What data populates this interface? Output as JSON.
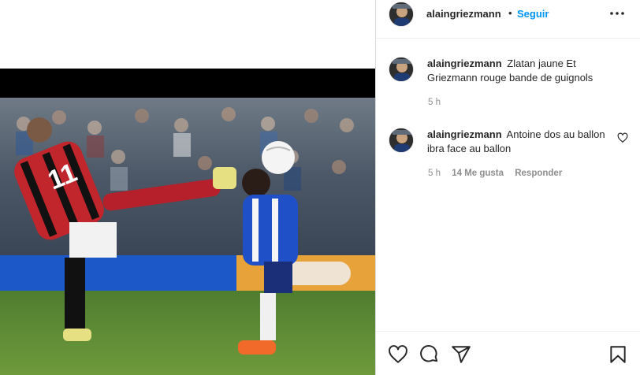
{
  "post": {
    "author": "alaingriezmann",
    "separator": "•",
    "follow_label": "Seguir",
    "more_icon": "more-options-icon"
  },
  "comments": [
    {
      "username": "alaingriezmann",
      "text": "Zlatan jaune Et Griezmann rouge bande de guignols",
      "time": "5 h"
    },
    {
      "username": "alaingriezmann",
      "text": "Antoine dos au ballon ibra face au ballon",
      "time": "5 h",
      "likes": "14 Me gusta",
      "reply_label": "Responder"
    }
  ],
  "actions": {
    "like_icon": "heart-icon",
    "comment_icon": "comment-icon",
    "share_icon": "share-icon",
    "save_icon": "bookmark-icon"
  },
  "media": {
    "jersey_number": "11"
  },
  "colors": {
    "link": "#0095f6",
    "text": "#262626",
    "muted": "#8e8e8e",
    "border": "#dbdbdb"
  }
}
